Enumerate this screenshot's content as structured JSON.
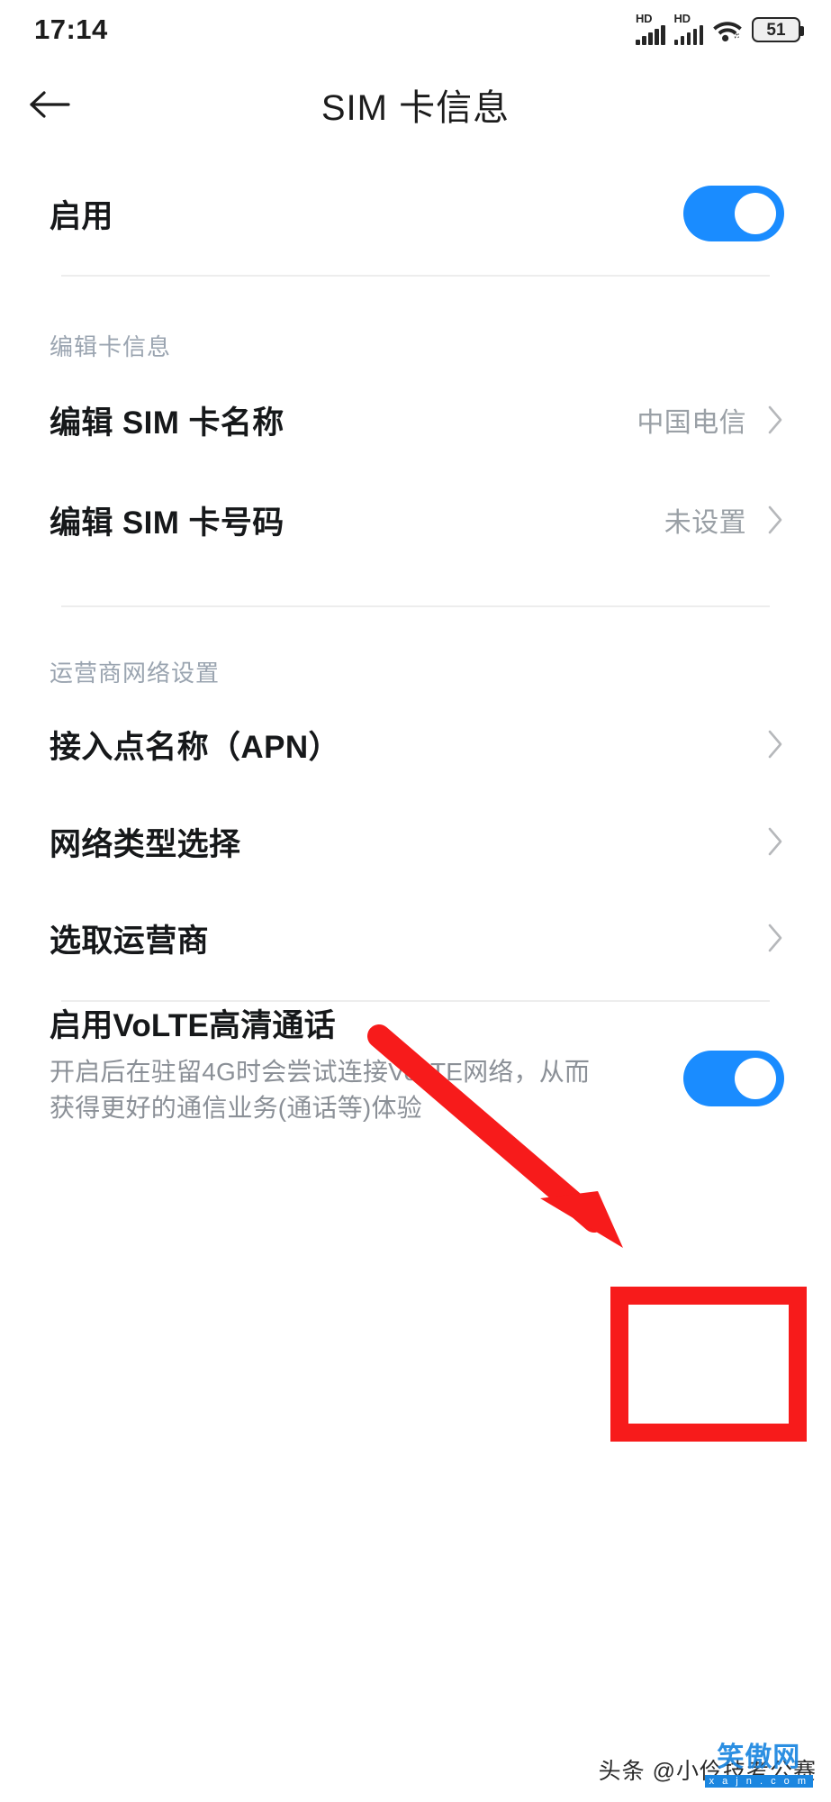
{
  "status_bar": {
    "time": "17:14",
    "signal_1_label": "HD",
    "signal_2_label": "HD",
    "wifi_icon": "wifi-icon",
    "battery_level": "51"
  },
  "app_bar": {
    "back_icon": "back-arrow-icon",
    "title": "SIM 卡信息"
  },
  "enable_row": {
    "title": "启用",
    "toggle_state": "on"
  },
  "section_card": {
    "label": "编辑卡信息",
    "items": [
      {
        "title": "编辑 SIM 卡名称",
        "value": "中国电信",
        "chevron": "chevron-right-icon"
      },
      {
        "title": "编辑 SIM 卡号码",
        "value": "未设置",
        "chevron": "chevron-right-icon"
      }
    ]
  },
  "section_network": {
    "label": "运营商网络设置",
    "items": [
      {
        "title": "接入点名称（APN）",
        "value": "",
        "chevron": "chevron-right-icon"
      },
      {
        "title": "网络类型选择",
        "value": "",
        "chevron": "chevron-right-icon"
      },
      {
        "title": "选取运营商",
        "value": "",
        "chevron": "chevron-right-icon"
      }
    ]
  },
  "volte_row": {
    "title": "启用VoLTE高清通话",
    "description": "开启后在驻留4G时会尝试连接VoLTE网络，从而获得更好的通信业务(通话等)体验",
    "toggle_state": "on"
  },
  "annotations": {
    "arrow_color": "#f71b1b",
    "highlight_box_color": "#f71b1b"
  },
  "watermark": {
    "text": "头条 @小伶技考公赛",
    "logo_main": "笑傲网",
    "logo_sub": "x a j n . c o m"
  },
  "colors": {
    "toggle_on": "#1a8cff",
    "title_text": "#16181a",
    "value_text": "#9aa0a6",
    "section_label": "#9aa4b0",
    "divider": "#ededed",
    "background": "#ffffff"
  }
}
